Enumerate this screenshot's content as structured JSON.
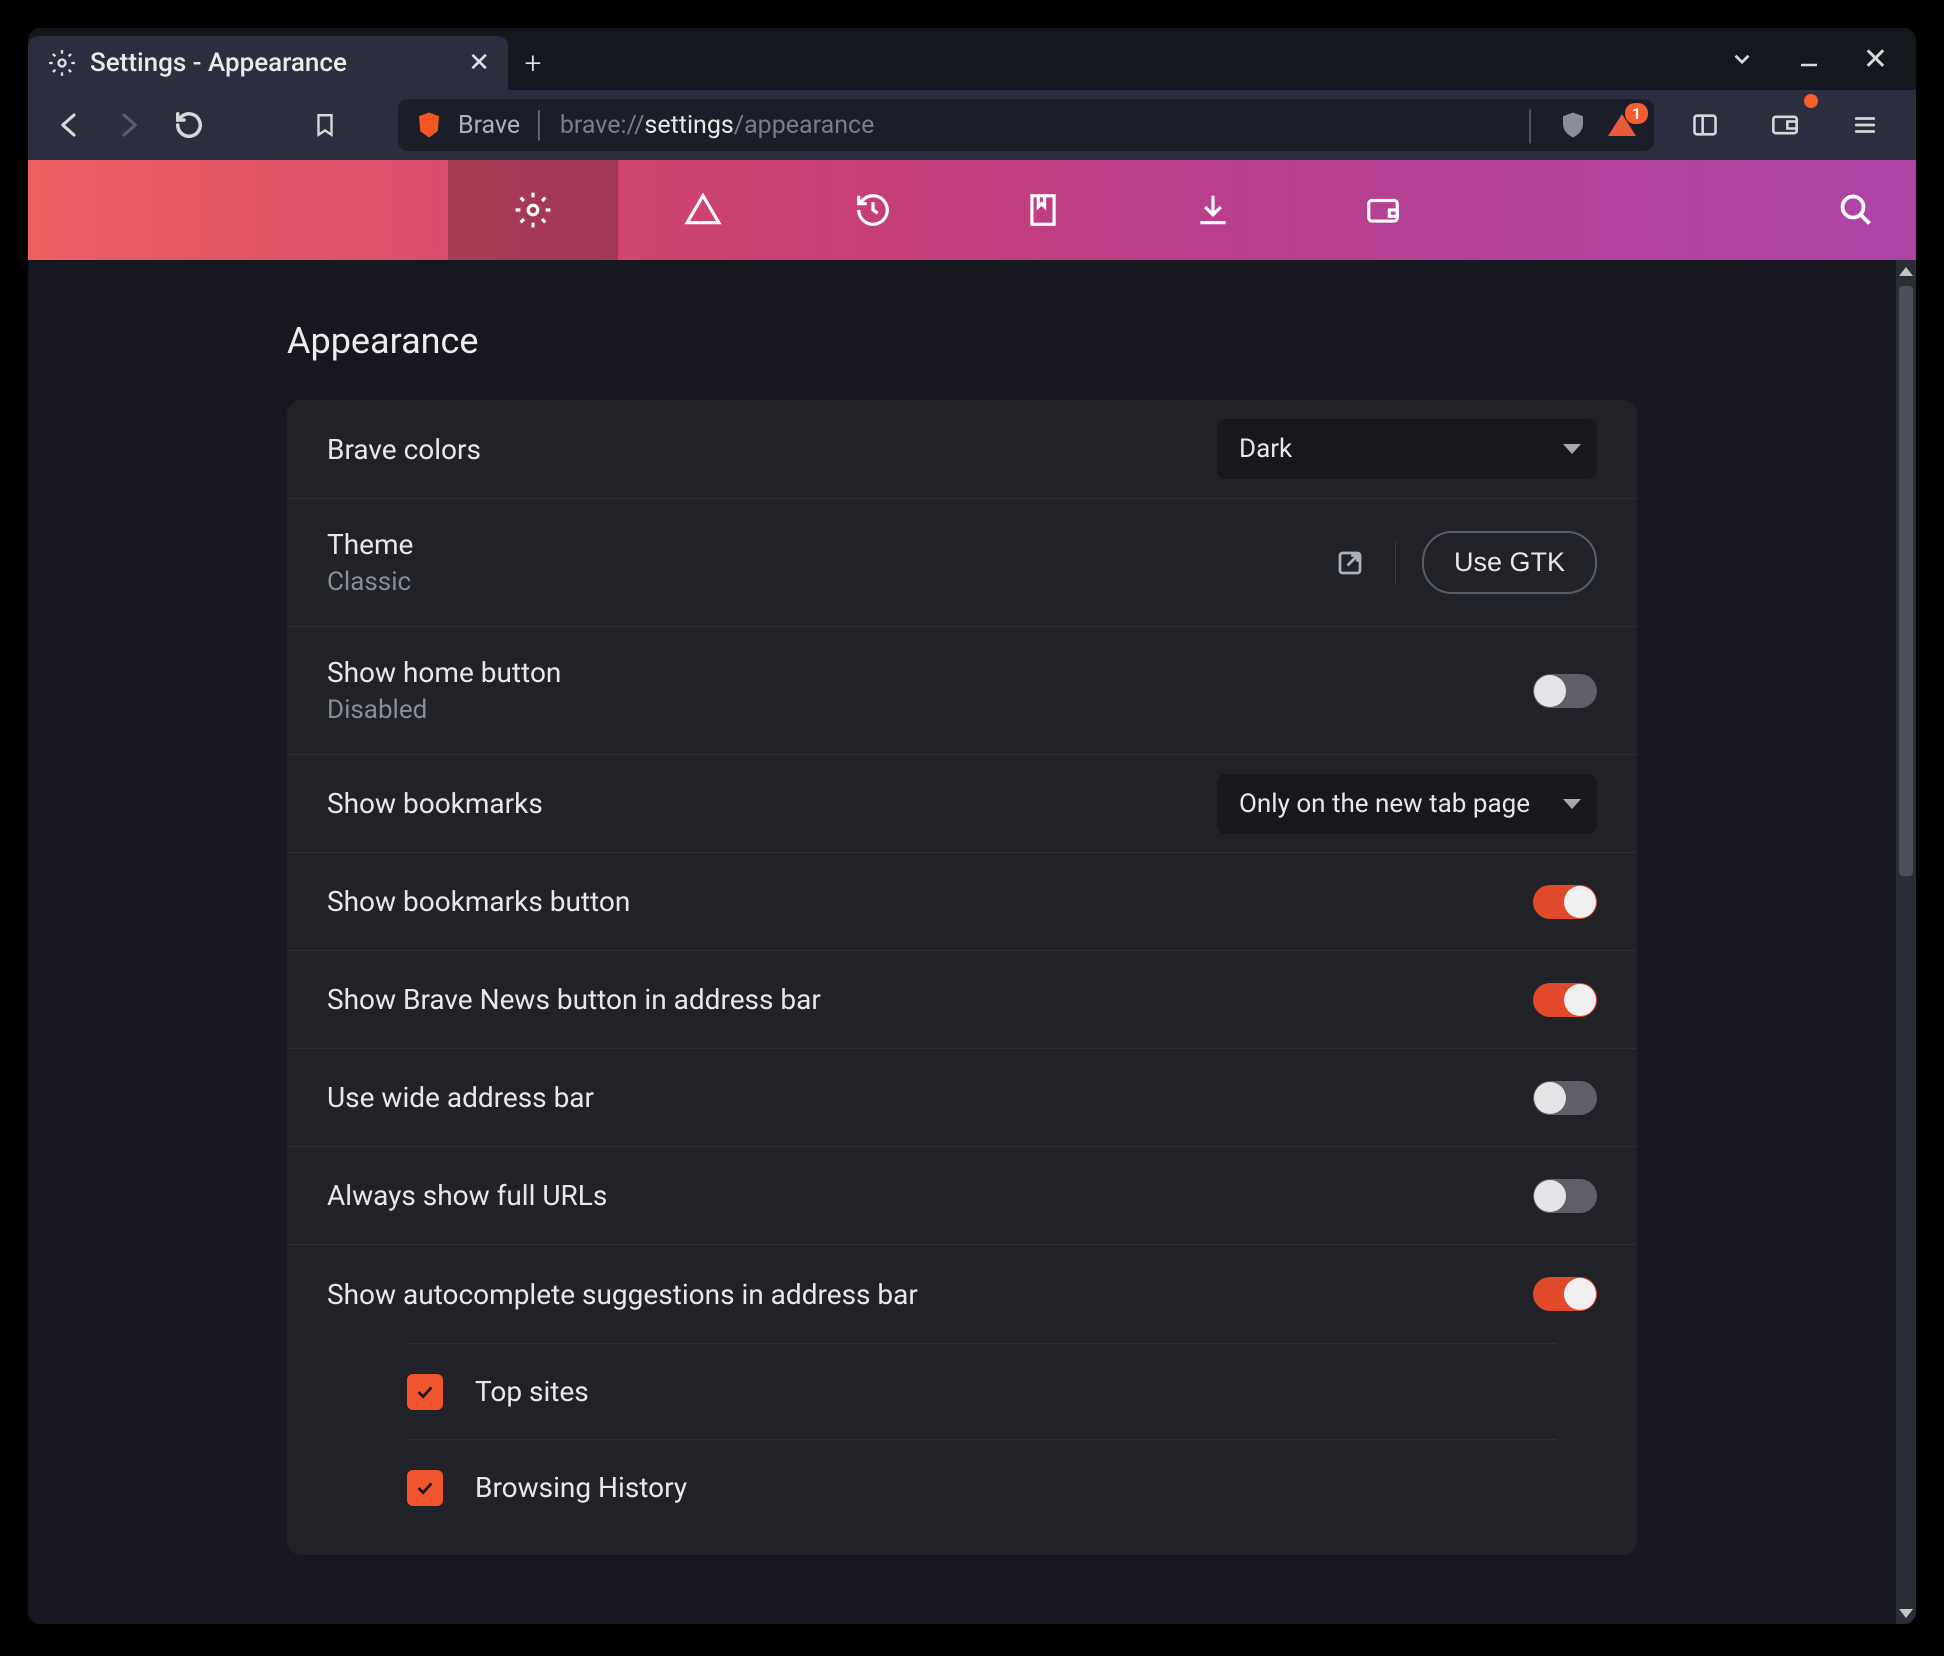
{
  "tab": {
    "title": "Settings - Appearance"
  },
  "address": {
    "label": "Brave",
    "path_prefix": "brave://",
    "path_mid": "settings",
    "path_suffix": "/appearance",
    "rewards_badge": "1"
  },
  "page": {
    "title": "Appearance"
  },
  "rows": {
    "brave_colors": {
      "label": "Brave colors",
      "value": "Dark"
    },
    "theme": {
      "label": "Theme",
      "sub": "Classic",
      "button": "Use GTK"
    },
    "home_button": {
      "label": "Show home button",
      "sub": "Disabled"
    },
    "bookmarks_bar": {
      "label": "Show bookmarks",
      "value": "Only on the new tab page"
    },
    "bookmarks_btn": {
      "label": "Show bookmarks button"
    },
    "news_btn": {
      "label": "Show Brave News button in address bar"
    },
    "wide_addr": {
      "label": "Use wide address bar"
    },
    "full_urls": {
      "label": "Always show full URLs"
    },
    "autocomplete": {
      "label": "Show autocomplete suggestions in address bar"
    }
  },
  "suggestions": {
    "top_sites": "Top sites",
    "history": "Browsing History"
  }
}
